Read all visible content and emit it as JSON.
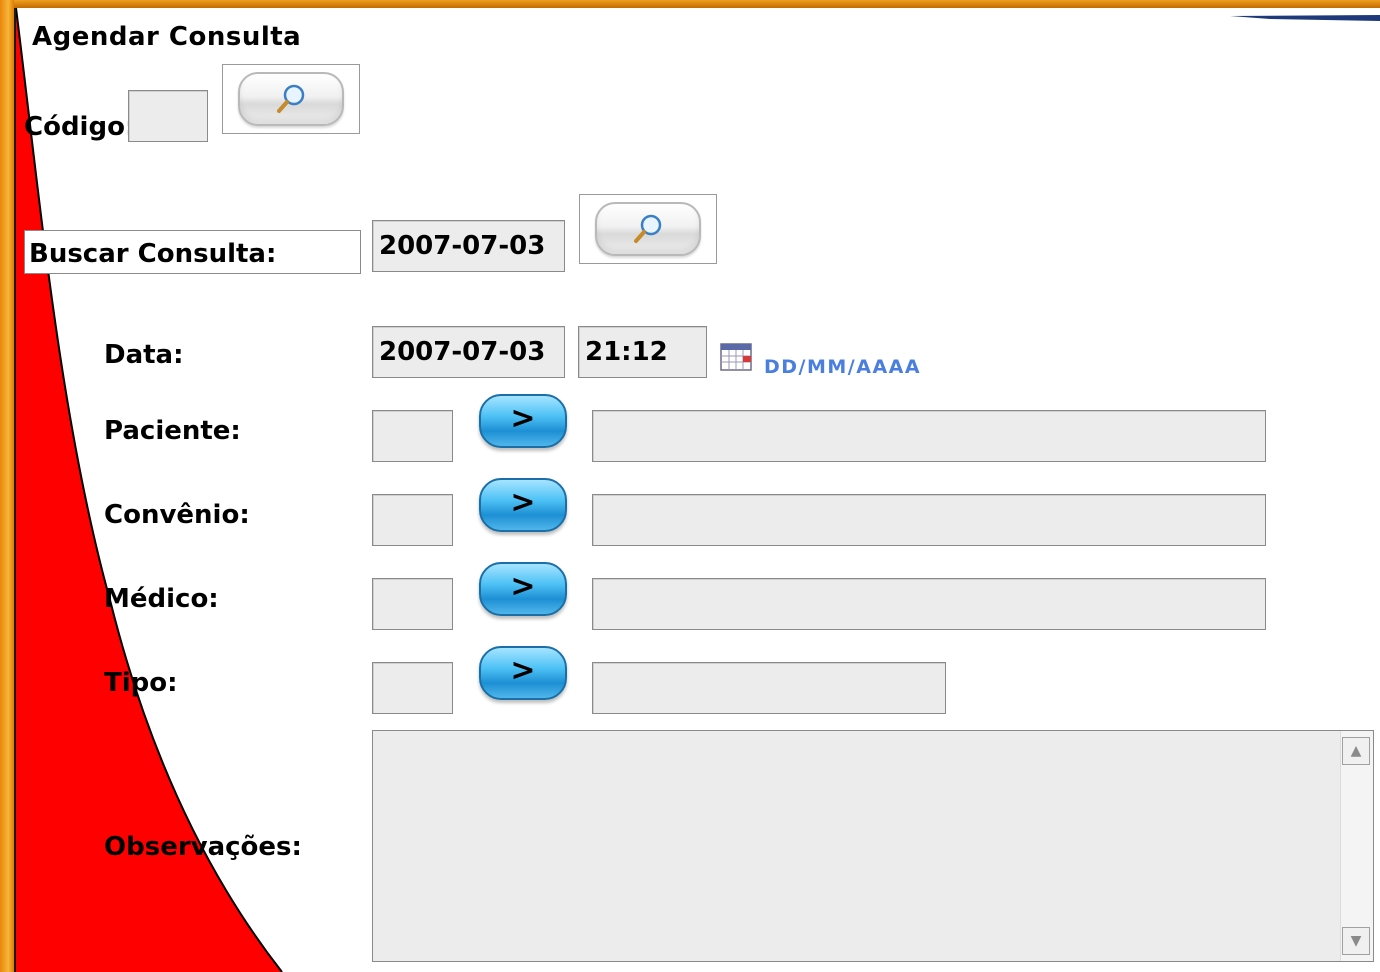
{
  "form": {
    "title": "Agendar Consulta",
    "codigo_label": "Código:",
    "codigo_value": "",
    "buscar_label": "Buscar Consulta:",
    "buscar_value": "2007-07-03",
    "data_label": "Data:",
    "data_value": "2007-07-03",
    "hora_value": "21:12",
    "date_hint": "DD/MM/AAAA",
    "paciente_label": "Paciente:",
    "convenio_label": "Convênio:",
    "medico_label": "Médico:",
    "tipo_label": "Tipo:",
    "observacoes_label": "Observações:",
    "go_label": ">",
    "paciente_code": "",
    "paciente_name": "",
    "convenio_code": "",
    "convenio_name": "",
    "medico_code": "",
    "medico_name": "",
    "tipo_code": "",
    "tipo_name": "",
    "observacoes_value": ""
  },
  "icons": {
    "search": "magnifier-icon",
    "calendar": "calendar-icon",
    "scroll_up": "scroll-up-arrow-icon",
    "scroll_down": "scroll-down-arrow-icon"
  },
  "colors": {
    "frame_orange": "#f7b638",
    "red_shape": "#ff0000",
    "field_bg": "#ececec",
    "go_button_blue": "#4ec2f5",
    "hint_blue": "#4a7fe0"
  }
}
